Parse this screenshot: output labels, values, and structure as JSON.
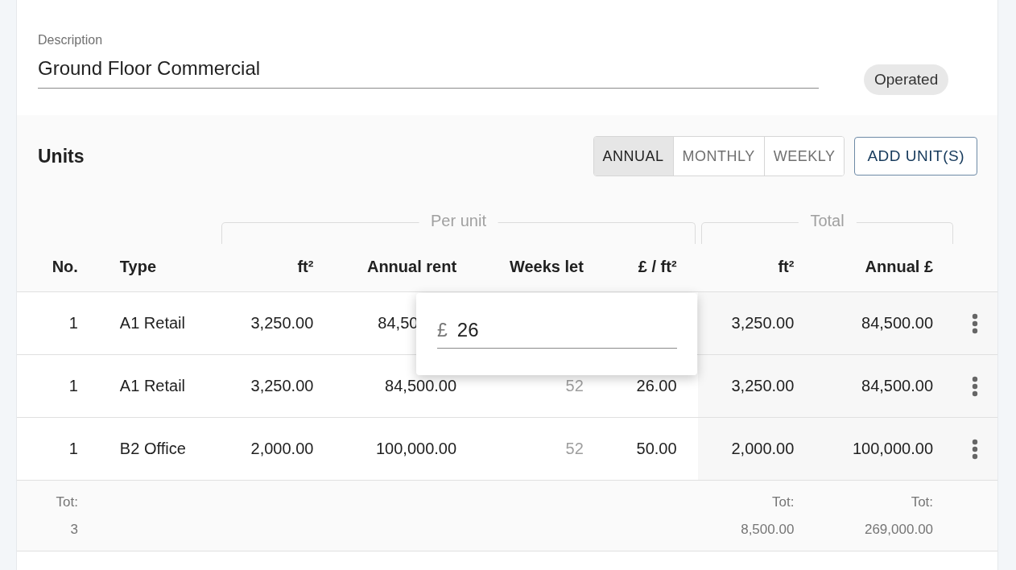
{
  "description": {
    "label": "Description",
    "value": "Ground Floor Commercial"
  },
  "status_chip": "Operated",
  "units": {
    "title": "Units",
    "periods": [
      {
        "label": "ANNUAL",
        "selected": true
      },
      {
        "label": "MONTHLY",
        "selected": false
      },
      {
        "label": "WEEKLY",
        "selected": false
      }
    ],
    "add_button": "ADD UNIT(S)",
    "groups": [
      "Per unit",
      "Total"
    ],
    "columns": [
      "No.",
      "Type",
      "ft²",
      "Annual rent",
      "Weeks let",
      "£ / ft²",
      "ft²",
      "Annual £"
    ],
    "rows": [
      {
        "no": "1",
        "type": "A1 Retail",
        "ft2": "3,250.00",
        "annual_rent": "84,50",
        "total_ft2": "3,250.00",
        "total_annual": "84,500.00",
        "editing": true
      },
      {
        "no": "1",
        "type": "A1 Retail",
        "ft2": "3,250.00",
        "annual_rent": "84,500.00",
        "weeks_let": "52",
        "rate": "26.00",
        "total_ft2": "3,250.00",
        "total_annual": "84,500.00",
        "editing": false
      },
      {
        "no": "1",
        "type": "B2 Office",
        "ft2": "2,000.00",
        "annual_rent": "100,000.00",
        "weeks_let": "52",
        "rate": "50.00",
        "total_ft2": "2,000.00",
        "total_annual": "100,000.00",
        "editing": false
      }
    ],
    "totals": [
      {
        "label": "Tot:",
        "value": "3"
      },
      {
        "label": "Tot:",
        "value": "8,500.00"
      },
      {
        "label": "Tot:",
        "value": "269,000.00"
      }
    ],
    "editor": {
      "prefix": "£",
      "value": "26"
    }
  }
}
